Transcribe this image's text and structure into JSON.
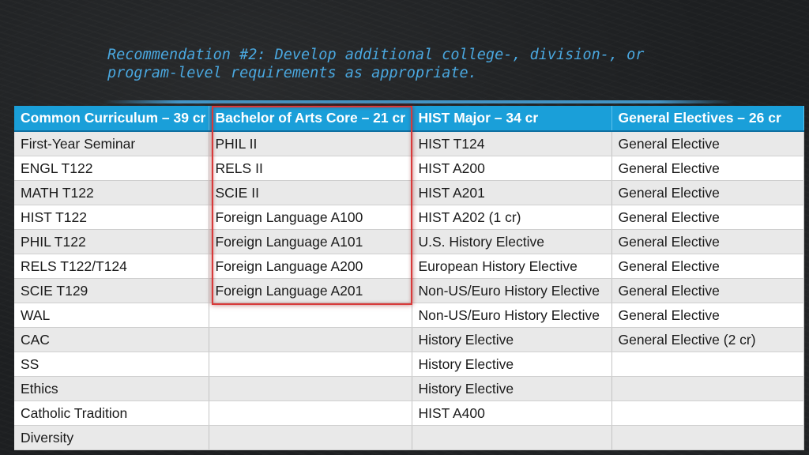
{
  "slide": {
    "title_line1": "Recommendation #2: Develop additional college-, division-, or",
    "title_line2": "program-level requirements as appropriate."
  },
  "colors": {
    "title_text": "#4aa8e0",
    "header_bg": "#1a9fd9",
    "header_text": "#ffffff",
    "row_alt": "#e9e9e9",
    "row": "#ffffff",
    "highlight_border": "#d93a3a",
    "background": "#1d1f21"
  },
  "table": {
    "headers": [
      "Common Curriculum – 39 cr",
      "Bachelor of Arts Core – 21 cr",
      "HIST Major – 34 cr",
      "General Electives – 26 cr"
    ],
    "rows": [
      [
        "First-Year Seminar",
        "PHIL II",
        "HIST T124",
        "General Elective"
      ],
      [
        "ENGL T122",
        "RELS II",
        "HIST A200",
        "General Elective"
      ],
      [
        "MATH T122",
        "SCIE II",
        "HIST A201",
        "General Elective"
      ],
      [
        "HIST T122",
        "Foreign Language A100",
        "HIST A202 (1 cr)",
        "General Elective"
      ],
      [
        "PHIL T122",
        "Foreign Language A101",
        "U.S. History Elective",
        "General Elective"
      ],
      [
        "RELS T122/T124",
        "Foreign Language A200",
        "European History Elective",
        "General Elective"
      ],
      [
        "SCIE T129",
        "Foreign Language A201",
        "Non-US/Euro History Elective",
        "General Elective"
      ],
      [
        "WAL",
        "",
        "Non-US/Euro History Elective",
        "General Elective"
      ],
      [
        "CAC",
        "",
        "History Elective",
        "General Elective (2 cr)"
      ],
      [
        "SS",
        "",
        "History Elective",
        ""
      ],
      [
        "Ethics",
        "",
        "History Elective",
        ""
      ],
      [
        "Catholic Tradition",
        "",
        "HIST A400",
        ""
      ],
      [
        "Diversity",
        "",
        "",
        ""
      ]
    ]
  }
}
